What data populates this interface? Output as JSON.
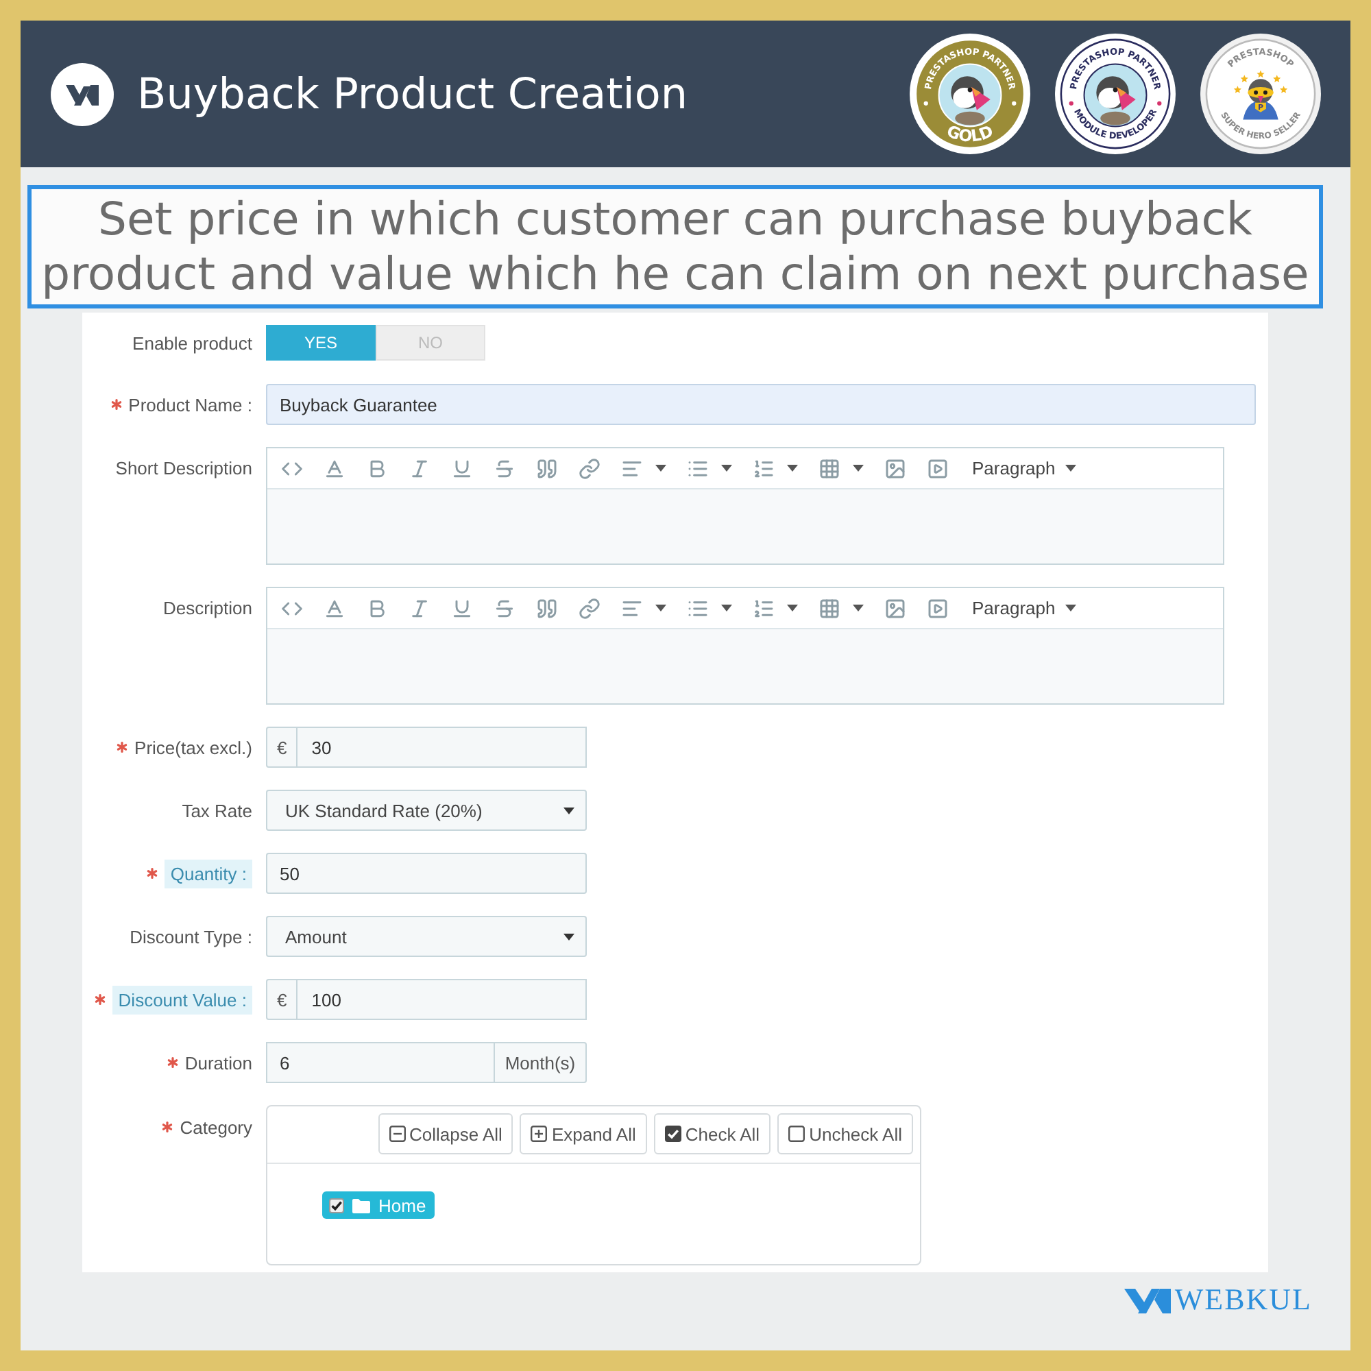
{
  "header": {
    "title": "Buyback Product Creation",
    "badges": [
      {
        "kind": "gold",
        "top_text": "PRESTASHOP PARTNER",
        "bottom_text": "GOLD"
      },
      {
        "kind": "developer",
        "top_text": "PRESTASHOP PARTNER",
        "bottom_text": "MODULE DEVELOPER"
      },
      {
        "kind": "hero",
        "top_text": "PRESTASHOP",
        "bottom_text": "SUPER HERO SELLER",
        "emblem_letter": "P"
      }
    ]
  },
  "banner": {
    "text": "Set price in which customer can purchase buyback product and value which he can claim on next purchase"
  },
  "form": {
    "fields": [
      {
        "kind": "toggle",
        "label": "Enable product",
        "required": false,
        "highlighted": false,
        "options": [
          {
            "label": "YES",
            "selected": true
          },
          {
            "label": "NO",
            "selected": false
          }
        ]
      },
      {
        "kind": "text",
        "label": "Product Name :",
        "required": true,
        "highlighted": false,
        "value": "Buyback Guarantee",
        "focused": true
      },
      {
        "kind": "editor",
        "label": "Short Description",
        "required": false,
        "highlighted": false,
        "format": "Paragraph"
      },
      {
        "kind": "editor",
        "label": "Description",
        "required": false,
        "highlighted": false,
        "format": "Paragraph"
      },
      {
        "kind": "addon",
        "label": "Price(tax excl.)",
        "required": true,
        "highlighted": false,
        "prefix": "€",
        "value": "30"
      },
      {
        "kind": "select",
        "label": "Tax Rate",
        "required": false,
        "highlighted": false,
        "value": "UK Standard Rate (20%)"
      },
      {
        "kind": "number",
        "label": "Quantity :",
        "required": true,
        "highlighted": true,
        "value": "50",
        "focused": false
      },
      {
        "kind": "select",
        "label": "Discount Type :",
        "required": false,
        "highlighted": false,
        "value": "Amount"
      },
      {
        "kind": "addon",
        "label": "Discount Value :",
        "required": true,
        "highlighted": true,
        "prefix": "€",
        "value": "100"
      },
      {
        "kind": "addon",
        "label": "Duration",
        "required": true,
        "highlighted": false,
        "value": "6",
        "suffix": "Month(s)"
      },
      {
        "kind": "tree",
        "label": "Category",
        "required": true,
        "highlighted": false,
        "actions": [
          {
            "kind": "collapse",
            "label": "Collapse All"
          },
          {
            "kind": "expand",
            "label": "Expand All"
          },
          {
            "kind": "check",
            "label": "Check All"
          },
          {
            "kind": "uncheck",
            "label": "Uncheck All"
          }
        ],
        "items": [
          {
            "label": "Home",
            "checked": true,
            "selected": true
          }
        ]
      }
    ]
  },
  "brand": {
    "name": "WEBKUL"
  }
}
